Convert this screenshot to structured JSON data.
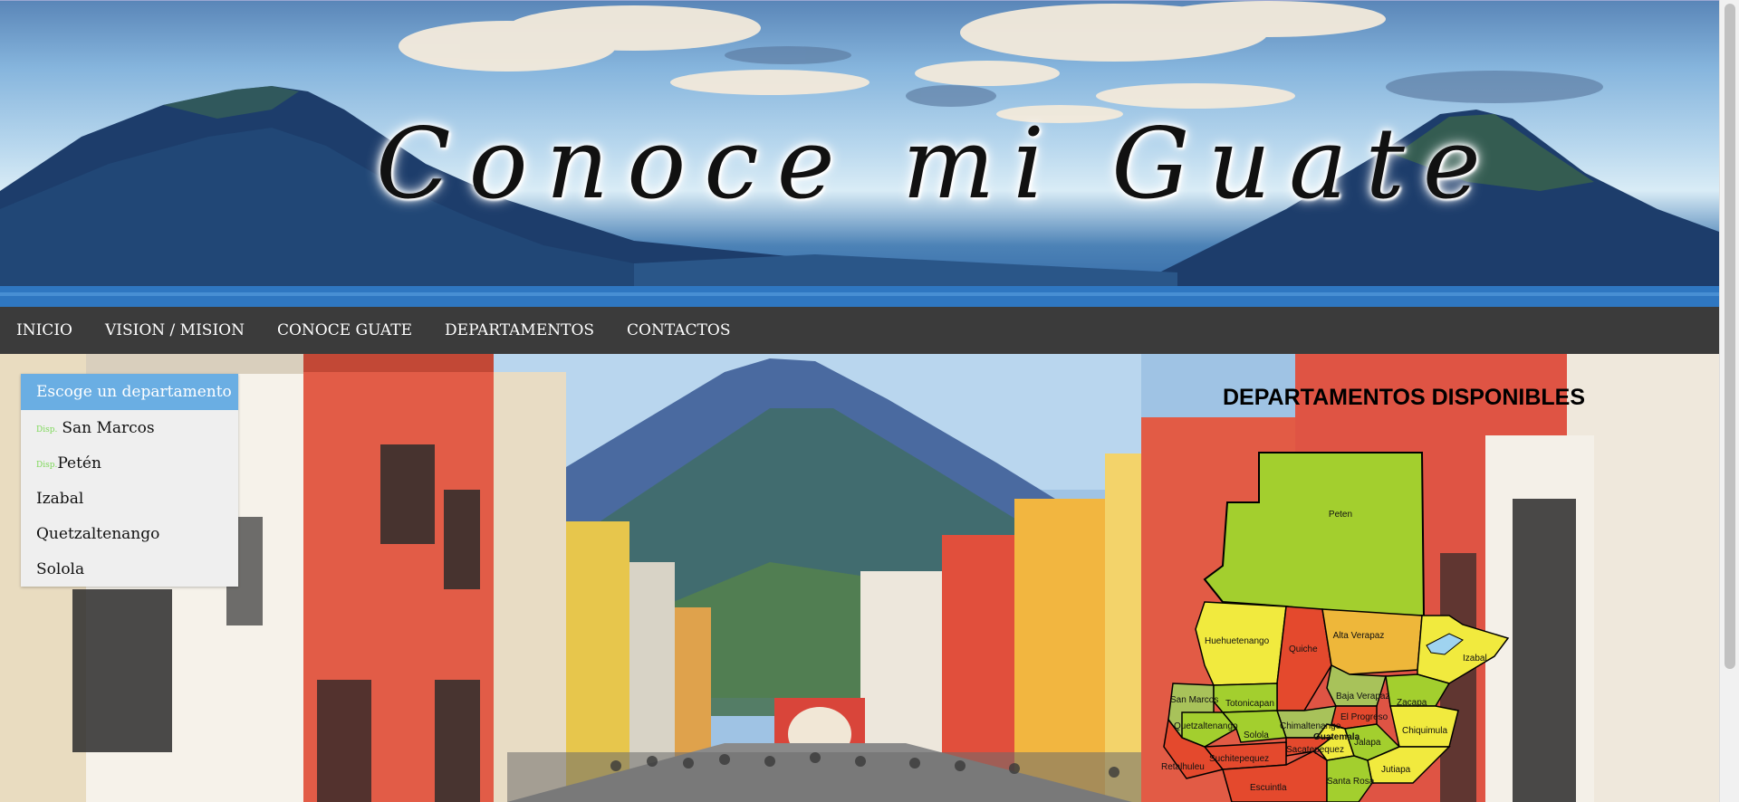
{
  "banner": {
    "title": "Conoce mi Guate"
  },
  "nav": {
    "items": [
      {
        "label": "INICIO"
      },
      {
        "label": "VISION / MISION"
      },
      {
        "label": "CONOCE GUATE"
      },
      {
        "label": "DEPARTAMENTOS"
      },
      {
        "label": "CONTACTOS"
      }
    ]
  },
  "dept_menu": {
    "header": "Escoge un departamento",
    "items": [
      {
        "disp": "Disp.",
        "label": "San Marcos"
      },
      {
        "disp": "Disp.",
        "label": "Petén"
      },
      {
        "disp": "",
        "label": "Izabal"
      },
      {
        "disp": "",
        "label": "Quetzaltenango"
      },
      {
        "disp": "",
        "label": "Solola"
      }
    ]
  },
  "available": {
    "title": "DEPARTAMENTOS DISPONIBLES"
  },
  "map": {
    "labels": [
      "Peten",
      "Huehuetenango",
      "Quiche",
      "Alta Verapaz",
      "Izabal",
      "San Marcos",
      "Totonicapan",
      "Baja Verapaz",
      "Zacapa",
      "Quetzaltenango",
      "Chimaltenango",
      "El Progreso",
      "Solola",
      "Guatemala",
      "Chiquimula",
      "Sacatepequez",
      "Jalapa",
      "Suchitepequez",
      "Retalhuleu",
      "Jutiapa",
      "Escuintla",
      "Santa Rosa"
    ],
    "colors": {
      "green": "#a3cf2e",
      "yellow": "#f1ea3e",
      "orange": "#eeb73a",
      "red": "#e4492d",
      "sage": "#a8c25a",
      "lake": "#9fd3f0"
    }
  },
  "colors": {
    "nav_bg": "#3b3b3b",
    "menu_header": "#6aaee3",
    "disp_green": "#7ed85a"
  }
}
